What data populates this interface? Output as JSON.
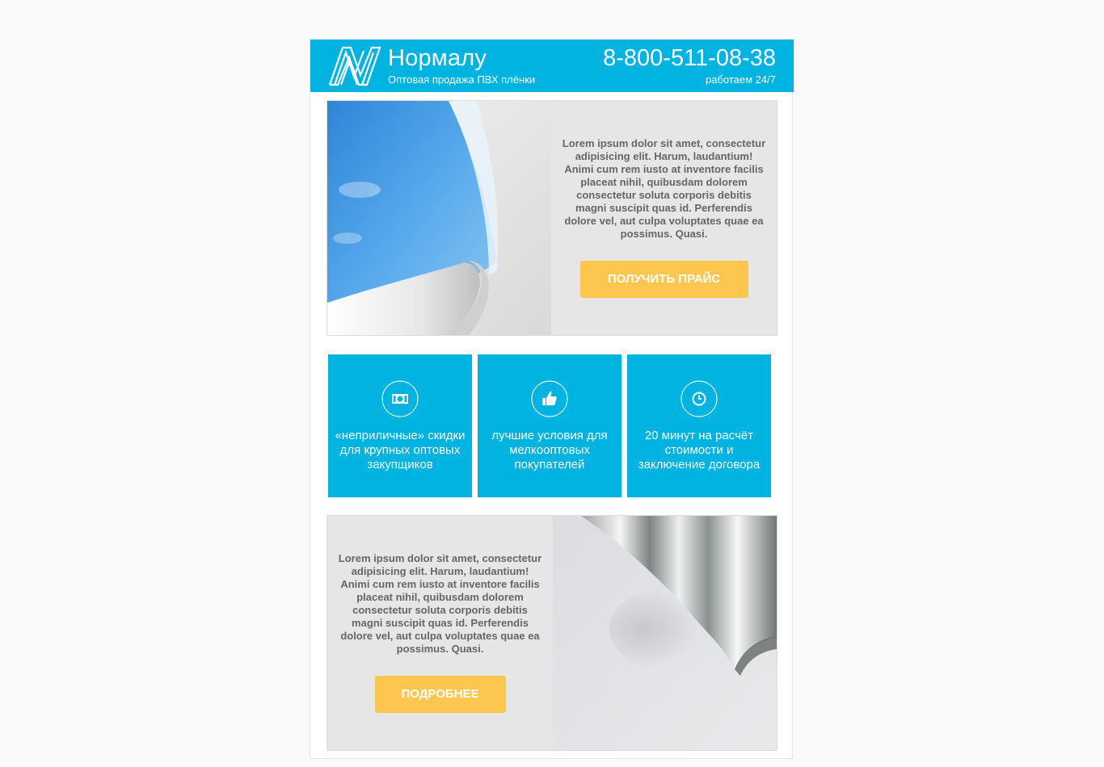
{
  "header": {
    "brand_name": "Нормалу",
    "tagline": "Оптовая продажа ПВХ плёнки",
    "phone": "8-800-511-08-38",
    "hours": "работаем 24/7"
  },
  "promo_top": {
    "text": "Lorem ipsum dolor sit amet, consectetur adipisicing elit. Harum, laudantium! Animi cum rem iusto at inventore facilis placeat nihil, quibusdam dolorem consectetur soluta corporis debitis magni suscipit quas id. Perferendis dolore vel, aut culpa voluptates quae ea possimus. Quasi.",
    "button_label": "ПОЛУЧИТЬ ПРАЙС",
    "image_icon": "blue-pvc-film-curl-image"
  },
  "features": [
    {
      "icon": "money-icon",
      "text": "«неприличные» скидки для крупных оптовых закупщиков"
    },
    {
      "icon": "thumbs-up-icon",
      "text": "лучшие условия для мелкооптовых покупателей"
    },
    {
      "icon": "clock-icon",
      "text": "20 минут на расчёт стоимости и заключение договора"
    }
  ],
  "promo_bottom": {
    "text": "Lorem ipsum dolor sit amet, consectetur adipisicing elit. Harum, laudantium! Animi cum rem iusto at inventore facilis placeat nihil, quibusdam dolorem consectetur soluta corporis debitis magni suscipit quas id. Perferendis dolore vel, aut culpa voluptates quae ea possimus. Quasi.",
    "button_label": "ПОДРОБНЕЕ",
    "image_icon": "silver-film-curl-image"
  },
  "colors": {
    "brand": "#00b3e1",
    "accent": "#fdc74f",
    "panel": "#e6e6e6",
    "text": "#666666"
  }
}
